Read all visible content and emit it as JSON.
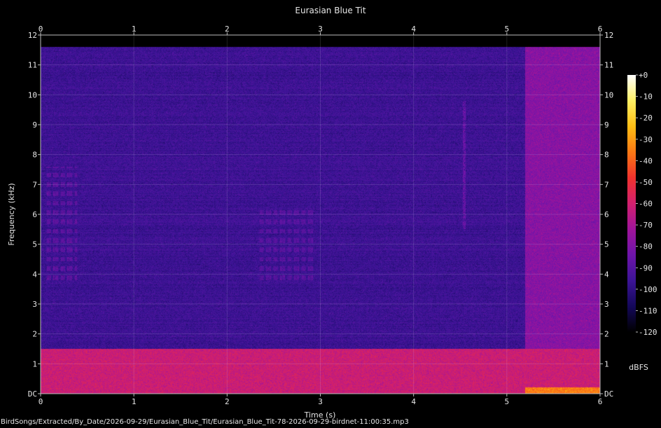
{
  "chart_data": {
    "type": "heatmap",
    "title": "Eurasian Blue Tit",
    "xlabel": "Time (s)",
    "ylabel": "Frequency (kHz)",
    "x_ticks": [
      "0",
      "1",
      "2",
      "3",
      "4",
      "5",
      "6"
    ],
    "y_ticks": [
      "DC",
      "1",
      "2",
      "3",
      "4",
      "5",
      "6",
      "7",
      "8",
      "9",
      "10",
      "11",
      "12"
    ],
    "xlim": [
      0,
      6
    ],
    "ylim": [
      0,
      12
    ],
    "grid": true,
    "colorbar": {
      "label": "dBFS",
      "ticks": [
        "+0",
        "-10",
        "-20",
        "-30",
        "-40",
        "-50",
        "-60",
        "-70",
        "-80",
        "-90",
        "-100",
        "-110",
        "-120"
      ],
      "range_db": [
        -120,
        0
      ],
      "colors": [
        "#000000",
        "#14085a",
        "#3c1496",
        "#6e14aa",
        "#a0149a",
        "#d2206e",
        "#f0322d",
        "#fa7814",
        "#ffbe14",
        "#fff064",
        "#ffffff"
      ]
    },
    "features": [
      {
        "kind": "band",
        "t": [
          0,
          6
        ],
        "f_khz": [
          0,
          1.5
        ],
        "level_db": -62
      },
      {
        "kind": "band",
        "t": [
          5.2,
          6
        ],
        "f_khz": [
          1.5,
          11.6
        ],
        "level_db": -78
      },
      {
        "kind": "band",
        "t": [
          5.2,
          6
        ],
        "f_khz": [
          0,
          0.2
        ],
        "level_db": -35
      },
      {
        "kind": "calls",
        "t": [
          0.05,
          0.4
        ],
        "f_khz": [
          3.8,
          7.6
        ],
        "level_db": -82
      },
      {
        "kind": "calls",
        "t": [
          2.35,
          2.95
        ],
        "f_khz": [
          3.8,
          6.2
        ],
        "level_db": -84
      },
      {
        "kind": "line",
        "t": [
          4.53,
          4.56
        ],
        "f_khz": [
          5.5,
          9.8
        ],
        "level_db": -84
      }
    ],
    "noise_floor_db": -96,
    "max_freq_khz": 11.6
  },
  "footer": {
    "filename": "BirdSongs/Extracted/By_Date/2026-09-29/Eurasian_Blue_Tit/Eurasian_Blue_Tit-78-2026-09-29-birdnet-11:00:35.mp3"
  }
}
